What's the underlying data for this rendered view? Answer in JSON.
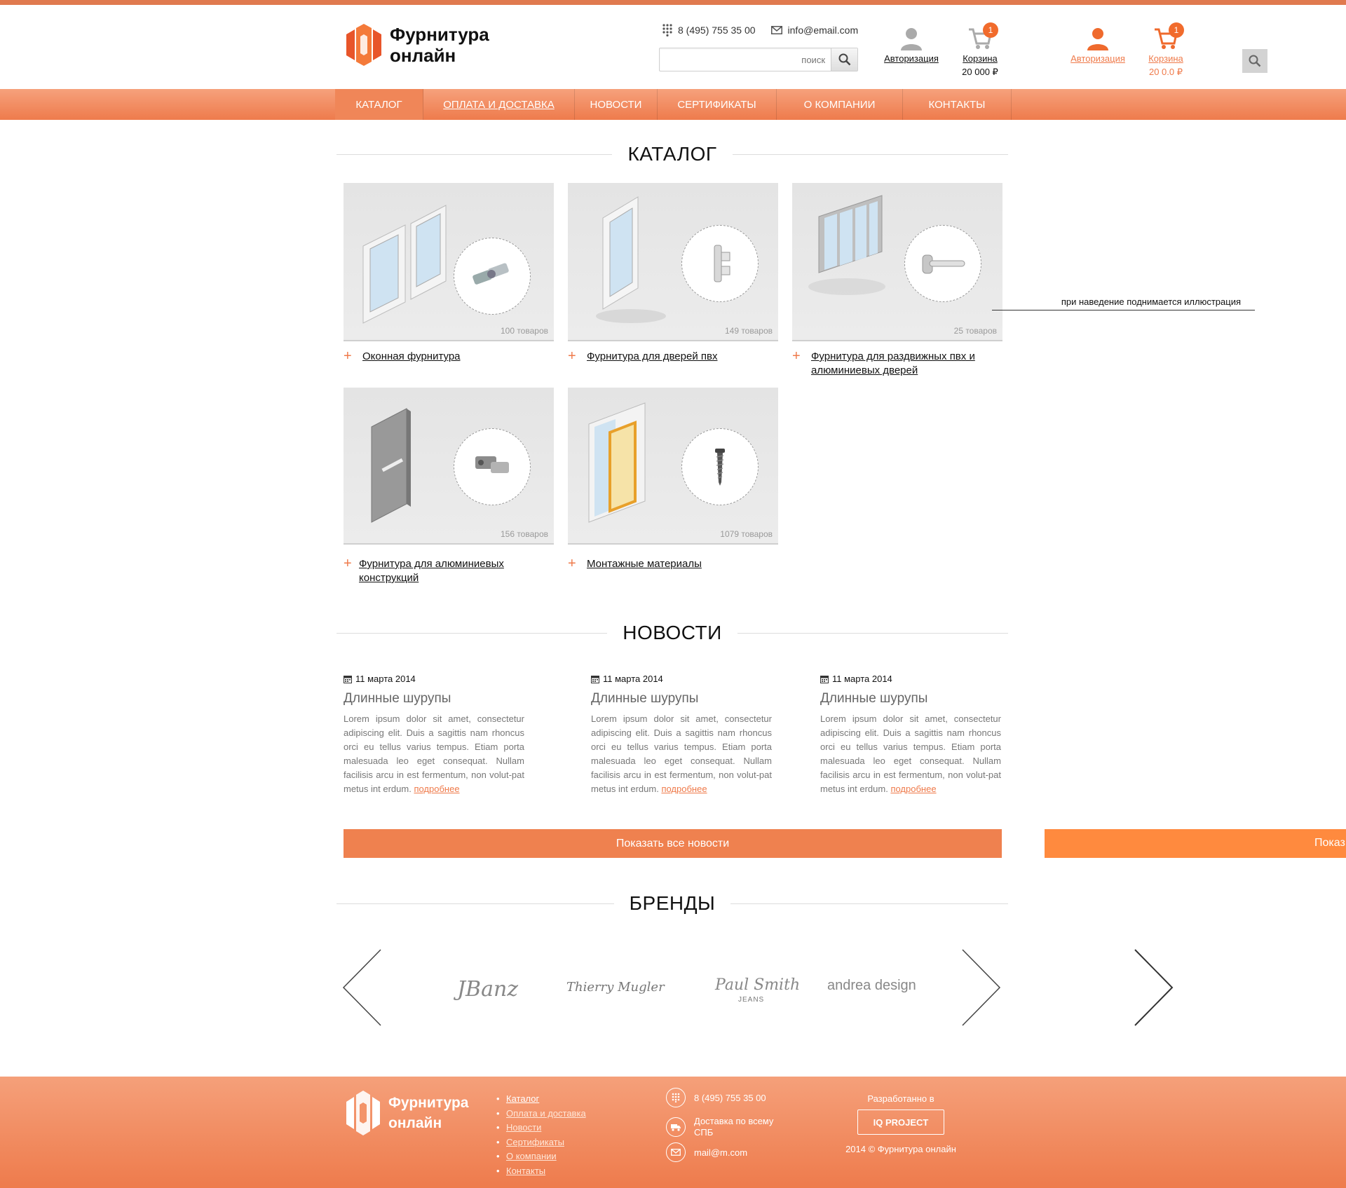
{
  "header": {
    "logo_text": "Фурнитура\nонлайн",
    "phone": "8 (495) 755 35 00",
    "email": "info@email.com",
    "search_placeholder": "поиск",
    "auth_label": "Авторизация",
    "cart_label": "Корзина",
    "cart_sum": "20 000 ₽",
    "cart_count": "1",
    "cart_hover_sum": "20 0.0 ₽"
  },
  "nav": {
    "items": [
      {
        "label": "КАТАЛОГ"
      },
      {
        "label": "ОПЛАТА И ДОСТАВКА"
      },
      {
        "label": "НОВОСТИ"
      },
      {
        "label": "СЕРТИФИКАТЫ"
      },
      {
        "label": "О КОМПАНИИ"
      },
      {
        "label": "КОНТАКТЫ"
      }
    ]
  },
  "catalog": {
    "title": "КАТАЛОГ",
    "hover_note": "при наведение поднимается иллюстрация",
    "items": [
      {
        "name": "Оконная фурнитура",
        "count": "100 товаров"
      },
      {
        "name": "Фурнитура для дверей пвх",
        "count": "149 товаров"
      },
      {
        "name": "Фурнитура для раздвижных пвх и алюминиевых дверей",
        "count": "25 товаров"
      },
      {
        "name": "Фурнитура для алюминиевых конструкций",
        "count": "156 товаров"
      },
      {
        "name": "Монтажные материалы",
        "count": "1079 товаров"
      }
    ]
  },
  "news": {
    "title": "НОВОСТИ",
    "items": [
      {
        "date": "11 марта 2014",
        "title": "Длинные шурупы",
        "text": "Lorem ipsum dolor sit amet, consectetur adipiscing elit. Duis a sagittis nam rhoncus orci eu tellus varius tempus. Etiam porta malesuada leo eget consequat. Nullam facilisis arcu in est fermentum, non volut-pat metus int erdum.",
        "more": "подробнее"
      },
      {
        "date": "11 марта 2014",
        "title": "Длинные шурупы",
        "text": "Lorem ipsum dolor sit amet, consectetur adipiscing elit. Duis a sagittis nam rhoncus orci eu tellus varius tempus. Etiam porta malesuada leo eget consequat. Nullam facilisis arcu in est fermentum, non volut-pat metus int erdum.",
        "more": "подробнее"
      },
      {
        "date": "11 марта 2014",
        "title": "Длинные шурупы",
        "text": "Lorem ipsum dolor sit amet, consectetur adipiscing elit. Duis a sagittis nam rhoncus orci eu tellus varius tempus. Etiam porta malesuada leo eget consequat. Nullam facilisis arcu in est fermentum, non volut-pat metus int erdum.",
        "more": "подробнее"
      }
    ],
    "show_all": "Показать все новости",
    "show_all_hover": "Показ"
  },
  "brands": {
    "title": "БРЕНДЫ",
    "items": [
      "JBanz",
      "Thierry Mugler",
      "Paul Smith",
      "JEANS",
      "andrea design"
    ]
  },
  "footer": {
    "logo_text": "Фурнитура\nонлайн",
    "menu": [
      "Каталог",
      "Оплата и доставка",
      "Новости",
      "Сертификаты",
      "О компании",
      "Контакты"
    ],
    "phone": "8 (495) 755 35 00",
    "delivery": "Доставка по всему СПБ",
    "email": "mail@m.com",
    "developed_by": "Разработанно в",
    "dev_logo": "IQ PROJECT",
    "copyright": "2014 © Фурнитура онлайн"
  },
  "colors": {
    "accent": "#ef7a4a",
    "badge": "#f16b2c"
  }
}
